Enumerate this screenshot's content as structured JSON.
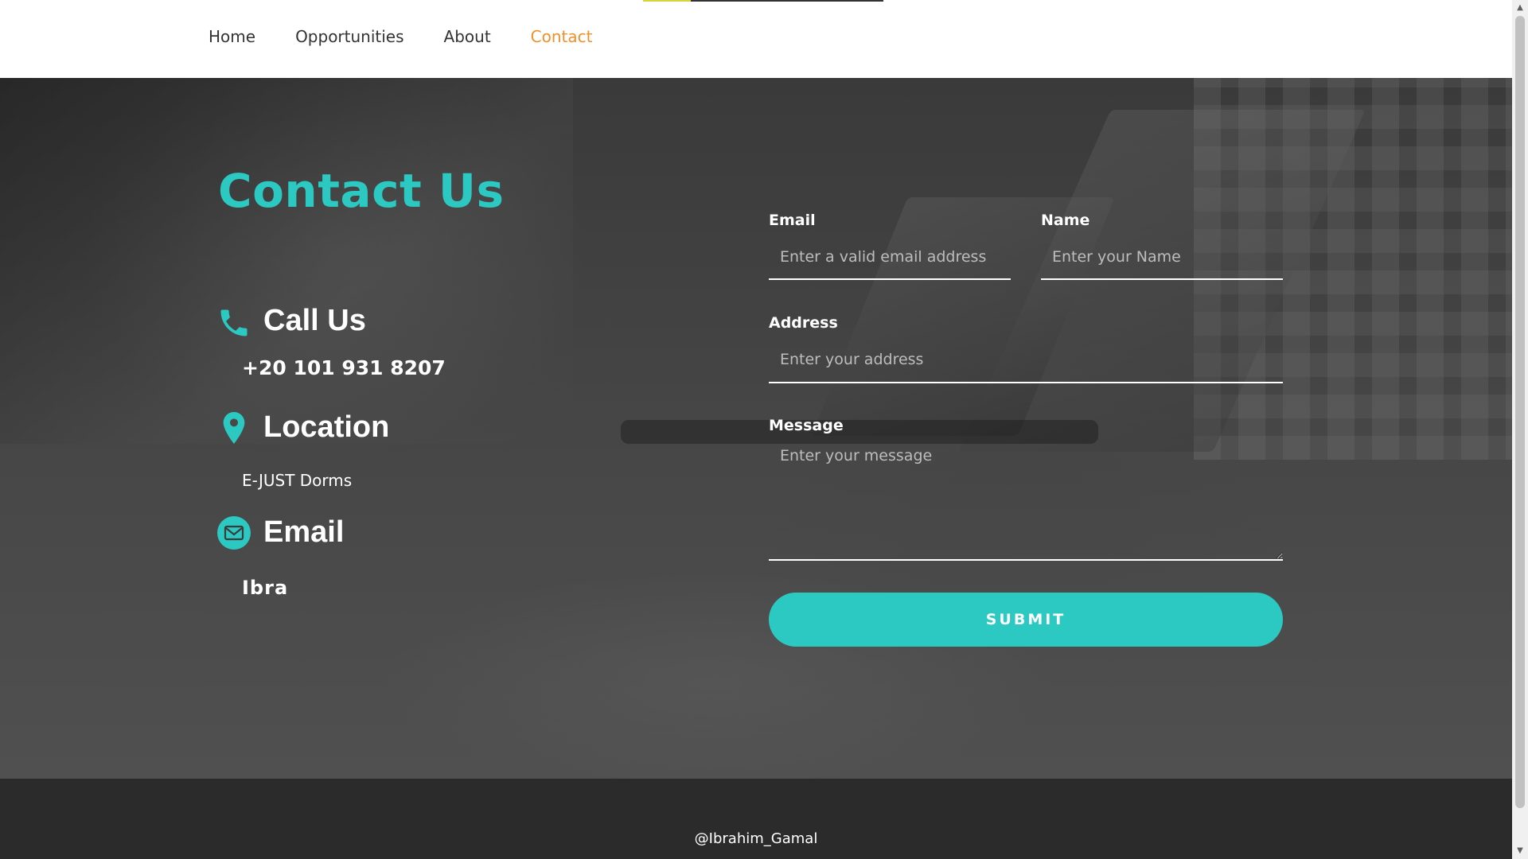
{
  "nav": {
    "items": [
      {
        "label": "Home",
        "active": false
      },
      {
        "label": "Opportunities",
        "active": false
      },
      {
        "label": "About",
        "active": false
      },
      {
        "label": "Contact",
        "active": true
      }
    ]
  },
  "contact": {
    "title": "Contact Us",
    "call": {
      "heading": "Call Us",
      "value": "+20 101 931 8207",
      "icon": "phone-icon"
    },
    "location": {
      "heading": "Location",
      "value": "E-JUST Dorms",
      "icon": "map-pin-icon"
    },
    "email": {
      "heading": "Email",
      "value": "Ibra",
      "icon": "envelope-icon"
    }
  },
  "form": {
    "email": {
      "label": "Email",
      "placeholder": "Enter a valid email address",
      "value": ""
    },
    "name": {
      "label": "Name",
      "placeholder": "Enter your Name",
      "value": ""
    },
    "address": {
      "label": "Address",
      "placeholder": "Enter your address",
      "value": ""
    },
    "message": {
      "label": "Message",
      "placeholder": "Enter your message",
      "value": ""
    },
    "submit_label": "SUBMIT"
  },
  "footer": {
    "text": "@Ibrahim_Gamal"
  },
  "colors": {
    "accent": "#2cc9c2",
    "nav_active": "#f0902a",
    "footer_bg": "#2b2b2b"
  }
}
